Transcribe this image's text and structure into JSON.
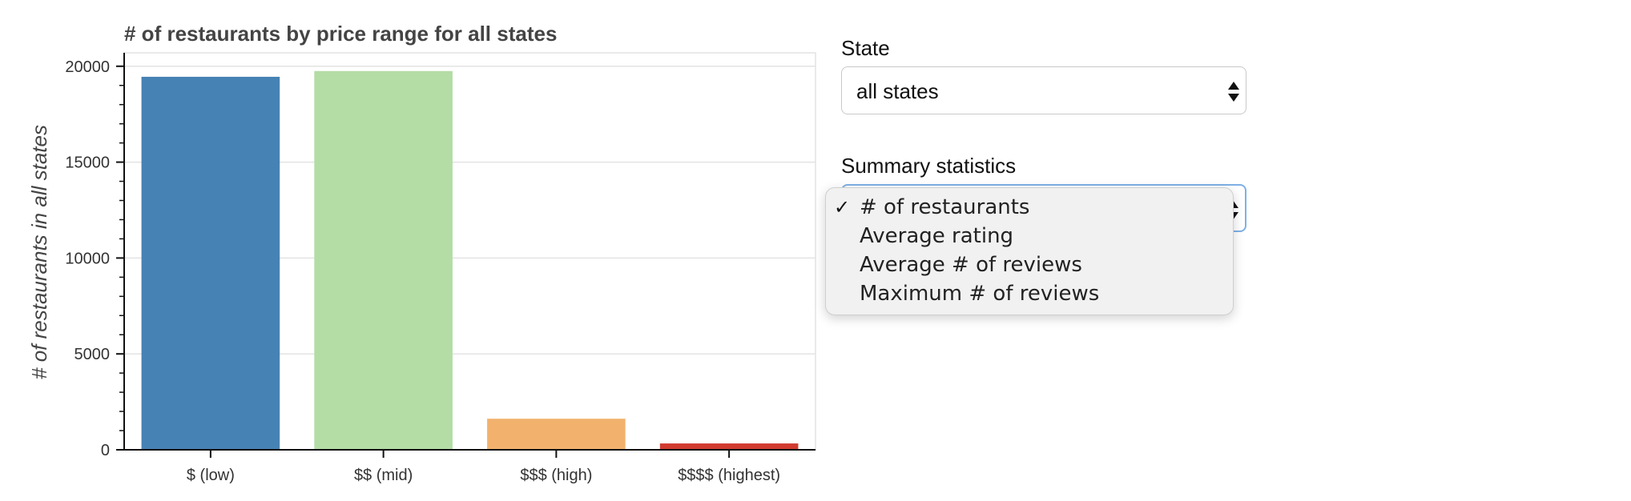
{
  "chart_data": {
    "type": "bar",
    "title": "# of restaurants by price range for all states",
    "xlabel": "",
    "ylabel": "# of restaurants in all states",
    "categories": [
      "$ (low)",
      "$$ (mid)",
      "$$$ (high)",
      "$$$$ (highest)"
    ],
    "values": [
      19450,
      19750,
      1620,
      330
    ],
    "colors": [
      "#4682b4",
      "#b4dca5",
      "#f2b26e",
      "#d13a2e"
    ],
    "ylim": [
      0,
      20700
    ],
    "yticks": [
      0,
      5000,
      10000,
      15000,
      20000
    ],
    "ytick_labels": [
      "0",
      "5000",
      "10000",
      "15000",
      "20000"
    ],
    "grid": true,
    "legend": "none"
  },
  "controls": {
    "state_label": "State",
    "state_value": "all states",
    "summary_label": "Summary statistics",
    "summary_value": "# of restaurants",
    "options": [
      "# of restaurants",
      "Average rating",
      "Average # of reviews",
      "Maximum # of reviews"
    ],
    "selected_index": 0,
    "check_glyph": "✓"
  }
}
